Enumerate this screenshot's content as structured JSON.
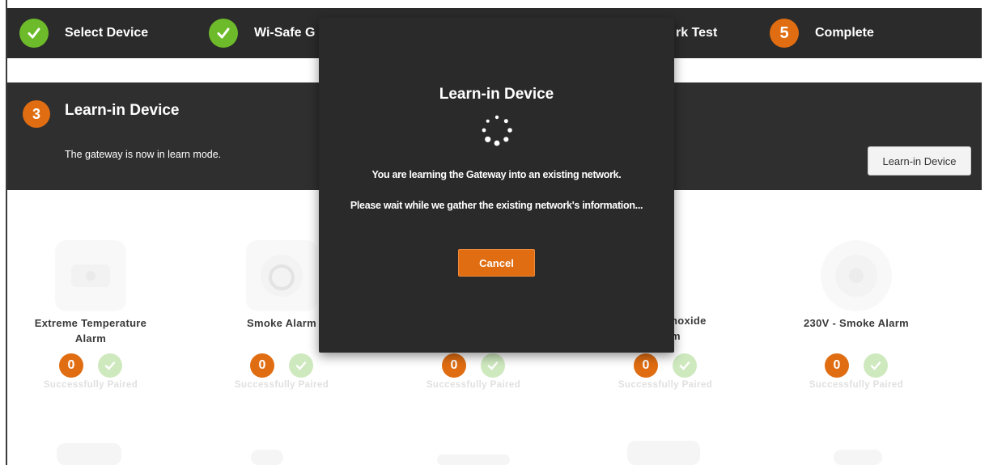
{
  "steps": [
    {
      "label": "Select Device",
      "done": true
    },
    {
      "label": "Wi-Safe G",
      "done": true
    },
    {
      "label": "rk Test",
      "done": false
    },
    {
      "number": "5",
      "label": "Complete",
      "done": false
    }
  ],
  "panel": {
    "step_number": "3",
    "title": "Learn-in Device",
    "description": "The gateway is now in learn mode.",
    "button_label": "Learn-in Device"
  },
  "devices": [
    {
      "name_line1": "Extreme Temperature",
      "name_line2": "Alarm",
      "count": "0",
      "status": "Successfully Paired"
    },
    {
      "name_line1": "Smoke Alarm",
      "name_line2": "",
      "count": "0",
      "status": "Successfully Paired"
    },
    {
      "name_line1": "",
      "name_line2": "",
      "count": "0",
      "status": "Successfully Paired"
    },
    {
      "name_line1": "noxide",
      "name_line2": "m",
      "count": "0",
      "status": "Successfully Paired"
    },
    {
      "name_line1": "230V - Smoke Alarm",
      "name_line2": "",
      "count": "0",
      "status": "Successfully Paired"
    }
  ],
  "modal": {
    "title": "Learn-in Device",
    "line1": "You are learning the Gateway into an existing network.",
    "line2": "Please wait while we gather the existing network's information...",
    "cancel_label": "Cancel"
  },
  "colors": {
    "accent_orange": "#e06d12",
    "success_green": "#6dbb2a",
    "dark_bg": "#2b2b2b"
  }
}
